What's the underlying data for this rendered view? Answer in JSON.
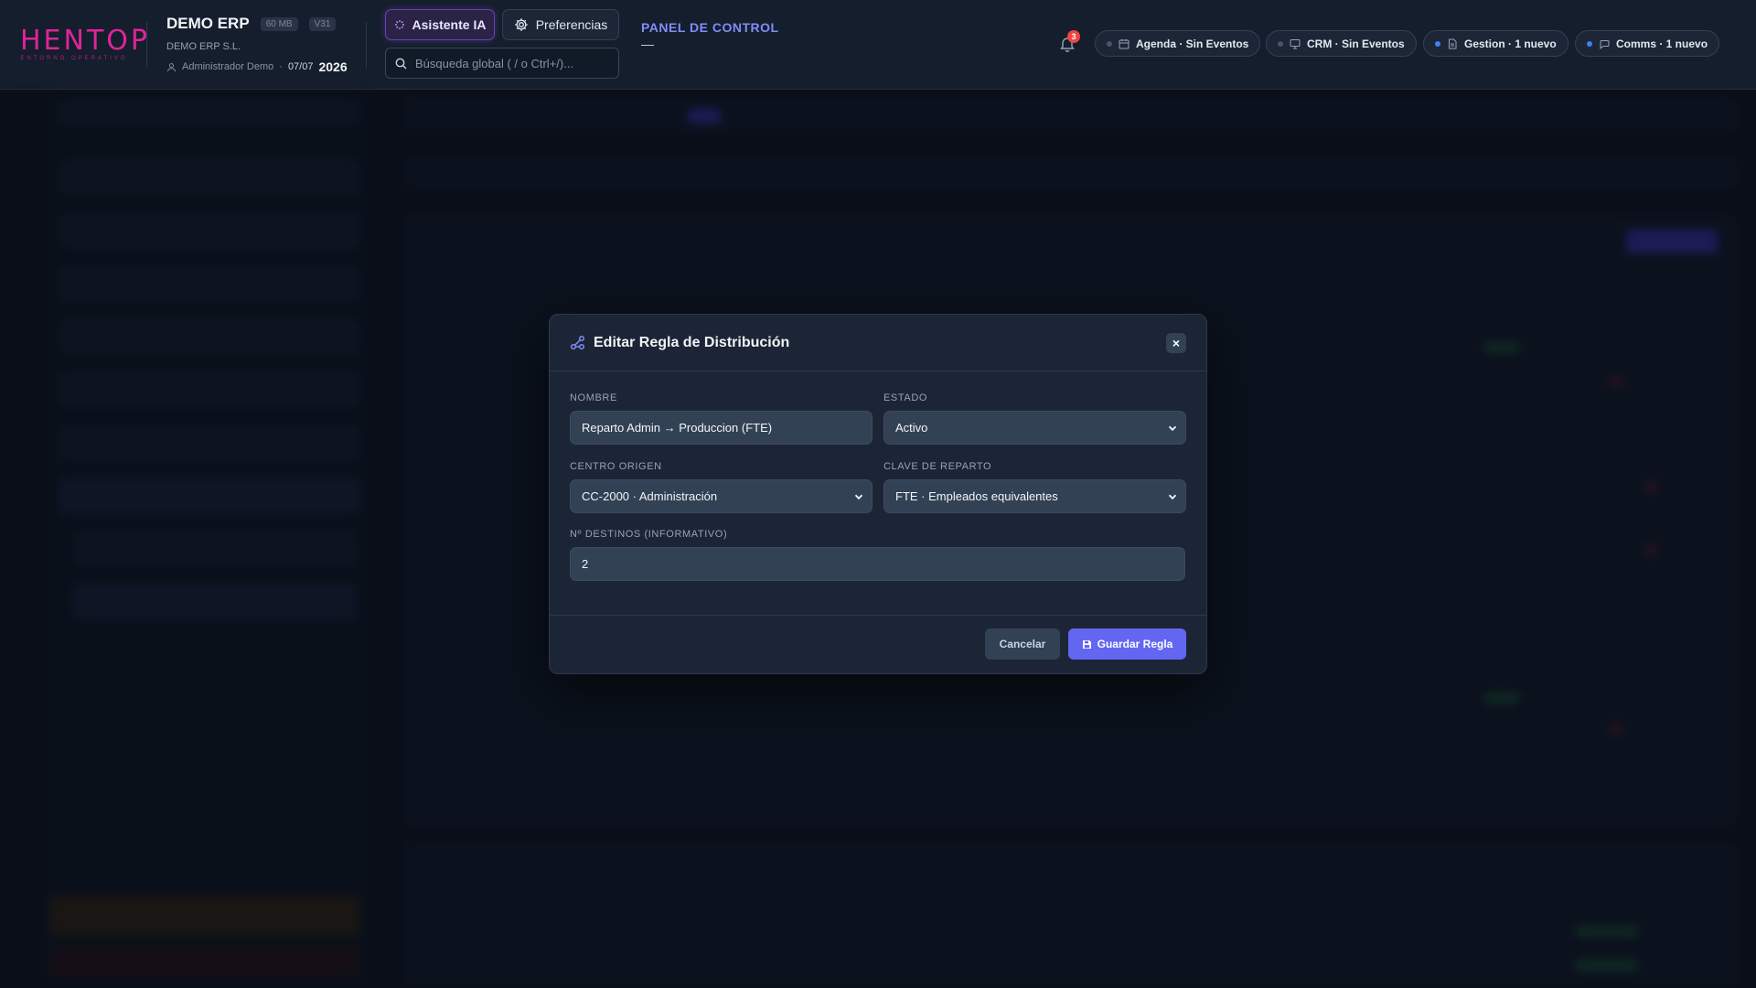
{
  "header": {
    "logo": {
      "text": "HENTOP",
      "tagline": "ENTORNO OPERATIVO"
    },
    "company": {
      "name": "DEMO ERP",
      "storage": "60 MB",
      "version": "V31",
      "legal_name": "DEMO ERP S.L.",
      "user": "Administrador Demo",
      "separator": "·",
      "date": "07/07",
      "year": "2026"
    },
    "ai_button": "Asistente IA",
    "prefs_button": "Preferencias",
    "search": {
      "placeholder": "Búsqueda global ( / o Ctrl+/)..."
    },
    "panel": {
      "title": "PANEL DE CONTROL",
      "subtitle": "—"
    },
    "notifications": {
      "count": "3"
    },
    "pills": [
      {
        "label": "Agenda · Sin Eventos",
        "icon": "calendar-icon",
        "dot_color": "#475569"
      },
      {
        "label": "CRM · Sin Eventos",
        "icon": "monitor-icon",
        "dot_color": "#475569"
      },
      {
        "label": "Gestion · 1 nuevo",
        "icon": "document-icon",
        "dot_color": "#3b82f6"
      },
      {
        "label": "Comms · 1 nuevo",
        "icon": "chat-icon",
        "dot_color": "#3b82f6"
      }
    ]
  },
  "modal": {
    "title": "Editar Regla de Distribución",
    "close_label": "×",
    "fields": {
      "nombre": {
        "label": "NOMBRE",
        "value": "Reparto Admin → Produccion (FTE)"
      },
      "estado": {
        "label": "ESTADO",
        "value": "Activo"
      },
      "centro_origen": {
        "label": "CENTRO ORIGEN",
        "value": "CC-2000 · Administración"
      },
      "clave_reparto": {
        "label": "CLAVE DE REPARTO",
        "value": "FTE · Empleados equivalentes"
      },
      "destinos": {
        "label": "Nº DESTINOS (INFORMATIVO)",
        "value": "2"
      }
    },
    "cancel_label": "Cancelar",
    "save_label": "Guardar Regla"
  },
  "colors": {
    "accent": "#6366f1",
    "brand": "#e0249a",
    "panel_title": "#818cf8",
    "badge": "#ef4444"
  }
}
